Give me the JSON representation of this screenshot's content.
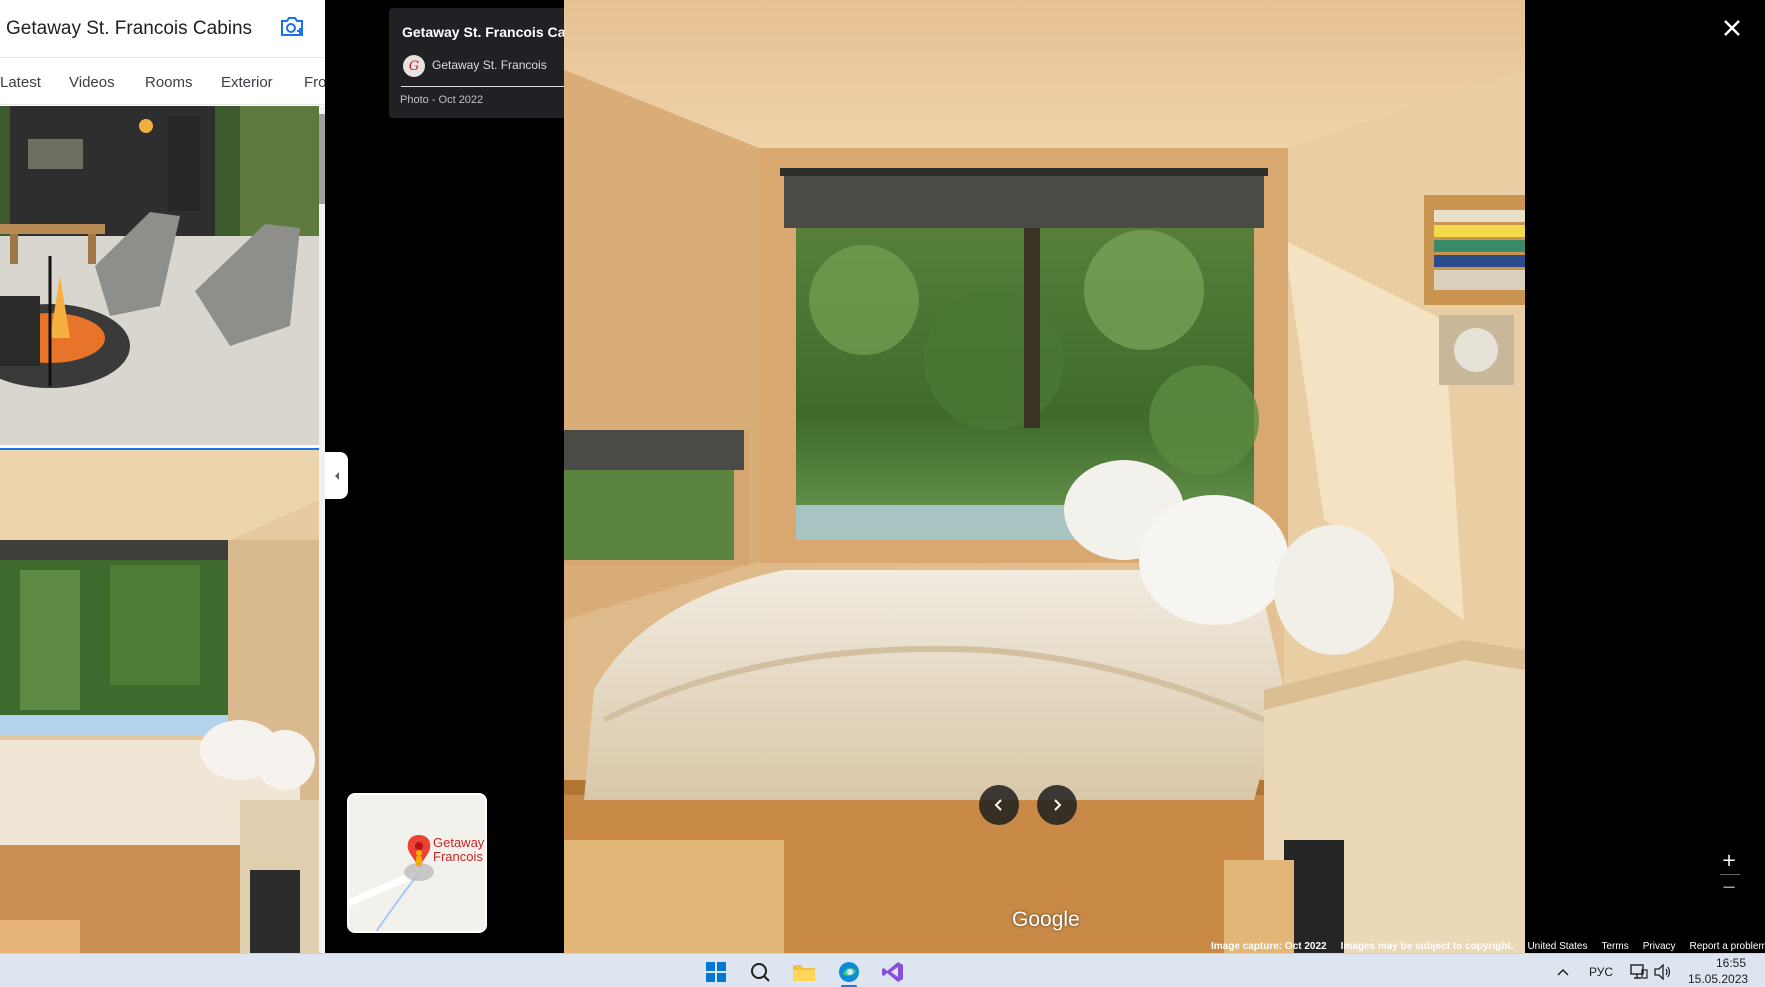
{
  "left_panel": {
    "title": "Getaway St. Francois Cabins",
    "tabs": [
      "Latest",
      "Videos",
      "Rooms",
      "Exterior",
      "Fro"
    ]
  },
  "info_card": {
    "title": "Getaway St. Francois Cabins",
    "avatar_letter": "G",
    "author": "Getaway St. Francois",
    "date": "Photo - Oct 2022"
  },
  "minimap": {
    "label_line1": "Getaway",
    "label_line2": "Francois"
  },
  "photo": {
    "logo": "Google"
  },
  "footer": {
    "capture": "Image capture: Oct 2022",
    "copyright": "Images may be subject to copyright.",
    "region": "United States",
    "terms": "Terms",
    "privacy": "Privacy",
    "report": "Report a problem"
  },
  "controls": {
    "zoom_in": "+",
    "zoom_out": "−"
  },
  "taskbar": {
    "language": "РУС",
    "time": "16:55",
    "date": "15.05.2023"
  },
  "icons": [
    "camera-plus-icon",
    "more-vert-icon",
    "close-icon",
    "chevron-left-icon",
    "chevron-right-icon",
    "collapse-arrow-icon",
    "map-pin-icon",
    "windows-start-icon",
    "search-icon",
    "file-explorer-icon",
    "edge-icon",
    "visual-studio-icon",
    "chevron-up-icon",
    "network-icon",
    "volume-icon"
  ],
  "colors": {
    "accent_blue": "#1a73e8",
    "card_bg": "#202124",
    "pin_red": "#ea4335"
  }
}
